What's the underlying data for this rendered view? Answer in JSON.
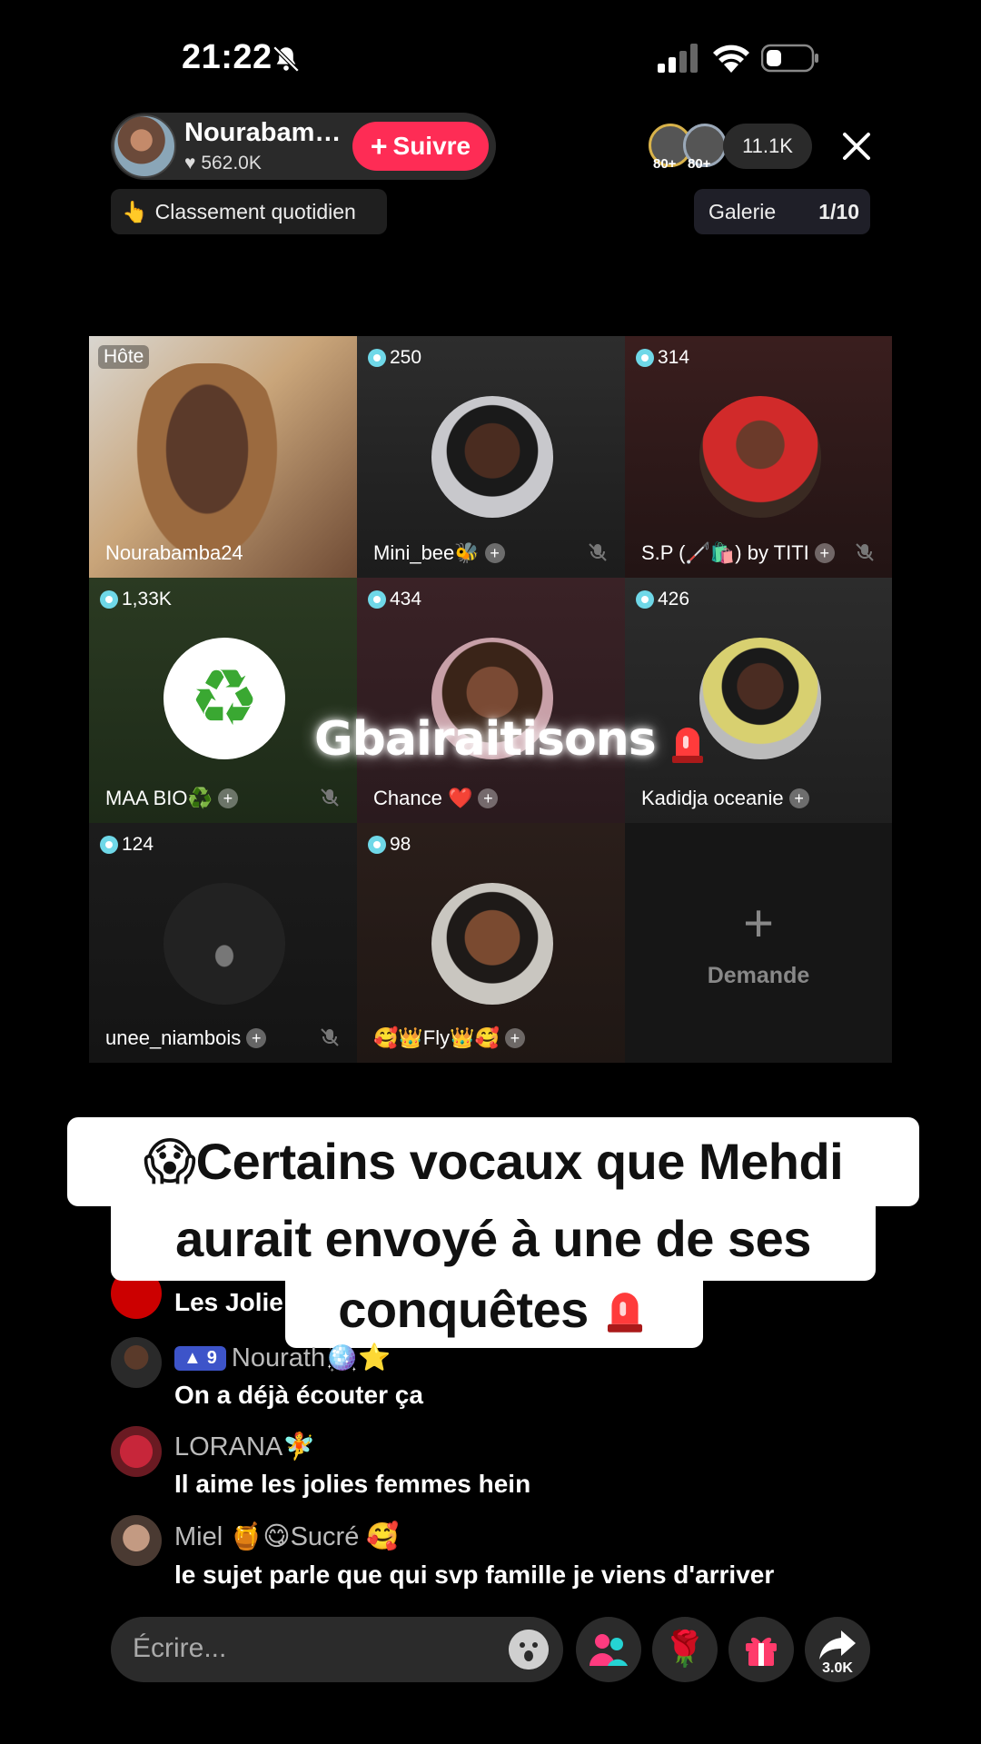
{
  "status_bar": {
    "time": "21:22"
  },
  "host": {
    "name": "Nourabam…",
    "likes": "562.0K",
    "follow_label": "Suivre"
  },
  "viewers": {
    "badge_1": "80+",
    "badge_2": "80+",
    "count": "11.1K"
  },
  "ranking": {
    "label": "Classement quotidien"
  },
  "gallery": {
    "label": "Galerie",
    "count": "1/10"
  },
  "grid": {
    "tiles": [
      {
        "tag": "Hôte",
        "name": "Nourabamba24"
      },
      {
        "coins": "250",
        "name": "Mini_bee🐝"
      },
      {
        "coins": "314",
        "name": "S.P (🦯🛍️) by TITI"
      },
      {
        "coins": "1,33K",
        "name": "MAA BIO♻️"
      },
      {
        "coins": "434",
        "name": "Chance ❤️"
      },
      {
        "coins": "426",
        "name": "Kadidja oceanie"
      },
      {
        "coins": "124",
        "name": "unee_niambois"
      },
      {
        "coins": "98",
        "name": "🥰👑Fly👑🥰"
      }
    ],
    "request_label": "Demande",
    "overlay_title": "Gbairaitisons"
  },
  "caption": {
    "line1": "😱Certains vocaux que Mehdi",
    "line2": "aurait envoyé à une de ses",
    "line3": "conquêtes"
  },
  "comments": [
    {
      "user": "",
      "text": "Les Jolie"
    },
    {
      "level": "9",
      "user": "Nourath🪩⭐",
      "text": "On a déjà écouter ça"
    },
    {
      "user": "LORANA🧚",
      "text": "Il aime les jolies femmes hein"
    },
    {
      "user": "Miel 🍯😋Sucré 🥰",
      "text": "le sujet parle que qui svp famille je viens d'arriver"
    }
  ],
  "bottom_bar": {
    "placeholder": "Écrire...",
    "share_count": "3.0K"
  },
  "colors": {
    "follow": "#fe2c55",
    "coin": "#6fd8e8",
    "level_badge": "#3d54c9"
  }
}
